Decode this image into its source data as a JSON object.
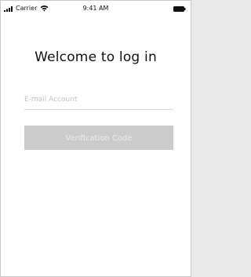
{
  "status_bar": {
    "carrier": "Carrier",
    "time": "9:41 AM",
    "signal_icon": "signal-bars-icon",
    "wifi_icon": "wifi-icon",
    "battery_icon": "battery-icon"
  },
  "login": {
    "title": "Welcome to log in",
    "email_placeholder": "E-mail Account",
    "verify_button_label": "Verification Code"
  },
  "colors": {
    "button_disabled_bg": "#cbcbcb",
    "button_text": "#ececec",
    "divider": "#d8d8d8"
  }
}
